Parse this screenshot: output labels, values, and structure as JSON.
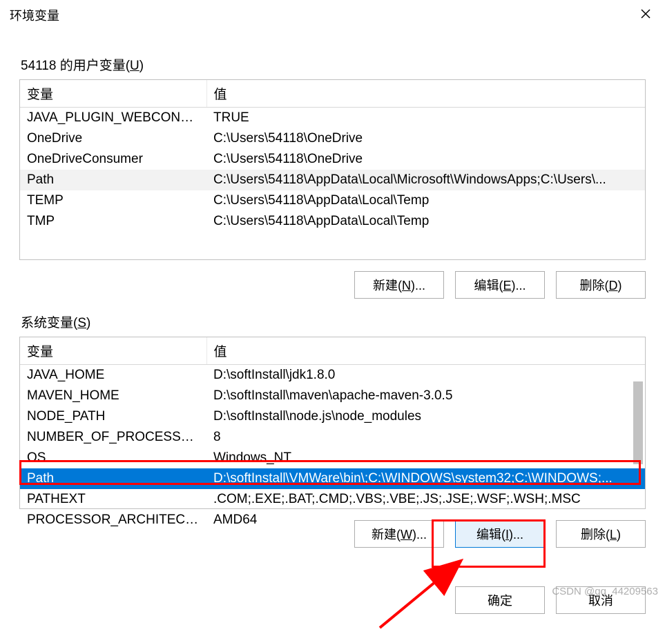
{
  "titlebar": {
    "title": "环境变量"
  },
  "user_section": {
    "label_prefix": "54118 的用户变量(",
    "label_hotkey": "U",
    "label_suffix": ")",
    "columns": {
      "name": "变量",
      "value": "值"
    },
    "rows": [
      {
        "name": "JAVA_PLUGIN_WEBCONTRO...",
        "value": "TRUE"
      },
      {
        "name": "OneDrive",
        "value": "C:\\Users\\54118\\OneDrive"
      },
      {
        "name": "OneDriveConsumer",
        "value": "C:\\Users\\54118\\OneDrive"
      },
      {
        "name": "Path",
        "value": "C:\\Users\\54118\\AppData\\Local\\Microsoft\\WindowsApps;C:\\Users\\..."
      },
      {
        "name": "TEMP",
        "value": "C:\\Users\\54118\\AppData\\Local\\Temp"
      },
      {
        "name": "TMP",
        "value": "C:\\Users\\54118\\AppData\\Local\\Temp"
      }
    ],
    "hover_index": 3,
    "buttons": {
      "new": {
        "pre": "新建(",
        "hot": "N",
        "post": ")..."
      },
      "edit": {
        "pre": "编辑(",
        "hot": "E",
        "post": ")..."
      },
      "delete": {
        "pre": "删除(",
        "hot": "D",
        "post": ")"
      }
    }
  },
  "system_section": {
    "label_prefix": "系统变量(",
    "label_hotkey": "S",
    "label_suffix": ")",
    "columns": {
      "name": "变量",
      "value": "值"
    },
    "rows": [
      {
        "name": "JAVA_HOME",
        "value": "D:\\softInstall\\jdk1.8.0"
      },
      {
        "name": "MAVEN_HOME",
        "value": "D:\\softInstall\\maven\\apache-maven-3.0.5"
      },
      {
        "name": "NODE_PATH",
        "value": "D:\\softInstall\\node.js\\node_modules"
      },
      {
        "name": "NUMBER_OF_PROCESSORS",
        "value": "8"
      },
      {
        "name": "OS",
        "value": "Windows_NT"
      },
      {
        "name": "Path",
        "value": "D:\\softInstall\\VMWare\\bin\\;C:\\WINDOWS\\system32;C:\\WINDOWS;..."
      },
      {
        "name": "PATHEXT",
        "value": ".COM;.EXE;.BAT;.CMD;.VBS;.VBE;.JS;.JSE;.WSF;.WSH;.MSC"
      },
      {
        "name": "PROCESSOR_ARCHITECTURE",
        "value": "AMD64"
      }
    ],
    "selected_index": 5,
    "buttons": {
      "new": {
        "pre": "新建(",
        "hot": "W",
        "post": ")..."
      },
      "edit": {
        "pre": "编辑(",
        "hot": "I",
        "post": ")..."
      },
      "delete": {
        "pre": "删除(",
        "hot": "L",
        "post": ")"
      }
    }
  },
  "dialog_buttons": {
    "ok": "确定",
    "cancel": "取消"
  },
  "watermark": "CSDN @qq_44209563"
}
